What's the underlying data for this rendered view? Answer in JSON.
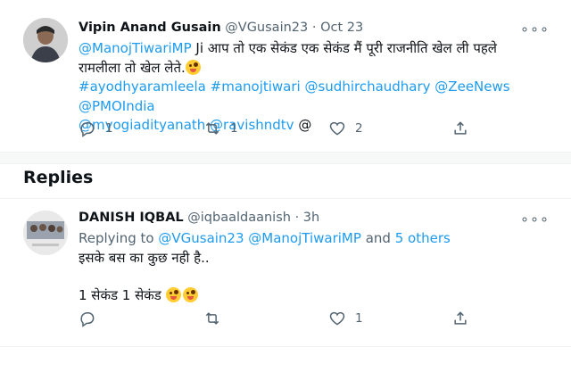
{
  "tweet": {
    "name": "Vipin Anand Gusain",
    "handle": "@VGusain23",
    "dot": "·",
    "date": "Oct 23",
    "line1_mention": "@ManojTiwariMP",
    "line1_text": "Ji आप तो एक सेकंड एक सेकंड मैं पूरी राजनीति खेल ली पहले",
    "line2_text": "रामलीला तो खेल लेते.",
    "tags_line1": "#ayodhyaramleela #manojtiwari @sudhirchaudhary @ZeeNews @PMOIndia",
    "tags_line2": "@myogiadityanath @ravishndtv",
    "tags_trail": "@",
    "reply_count": "1",
    "retweet_count": "1",
    "like_count": "2",
    "more": "∘∘∘"
  },
  "replies_title": "Replies",
  "reply": {
    "name": "DANISH IQBAL",
    "handle": "@iqbaaldaanish",
    "dot": "·",
    "time": "3h",
    "replying_prefix": "Replying to",
    "replying_users": "@VGusain23 @ManojTiwariMP",
    "replying_and": "and",
    "replying_others": "5 others",
    "line1": "इसके बस का कुछ नही है..",
    "line2": "1 सेकंड 1 सेकंड",
    "reply_count": "",
    "retweet_count": "",
    "like_count": "1",
    "more": "∘∘∘"
  },
  "icons": {
    "reply": "reply-icon",
    "retweet": "retweet-icon",
    "like": "heart-icon",
    "share": "share-icon",
    "more": "more-icon"
  },
  "colors": {
    "link": "#1d9bf0",
    "muted": "#536471",
    "text": "#0f1419"
  }
}
